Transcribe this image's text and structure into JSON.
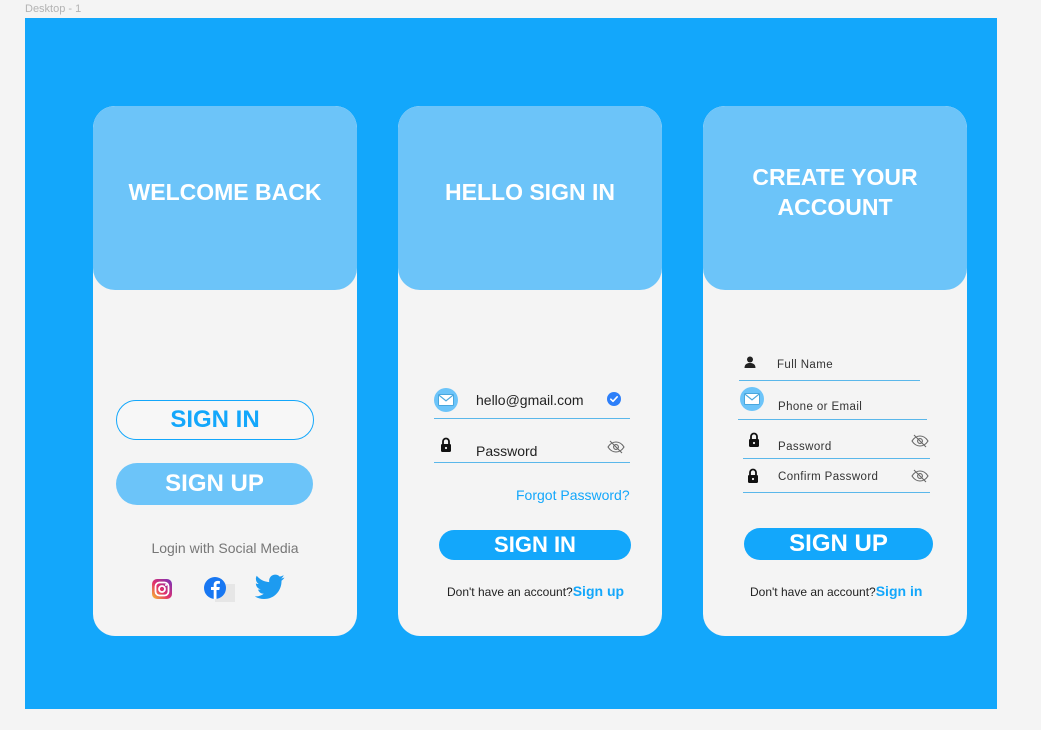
{
  "frame": {
    "label": "Desktop - 1"
  },
  "card1": {
    "title": "WELCOME BACK",
    "signin_label": "SIGN IN",
    "signup_label": "SIGN UP",
    "social_text": "Login with Social Media",
    "social_icons": [
      "instagram-icon",
      "facebook-icon",
      "twitter-icon"
    ]
  },
  "card2": {
    "title": "HELLO SIGN IN",
    "email_value": "hello@gmail.com",
    "password_placeholder": "Password",
    "forgot_label": "Forgot Password?",
    "signin_label": "SIGN IN",
    "footer_text": "Don't have an account?",
    "footer_link": "Sign up"
  },
  "card3": {
    "title": "CREATE YOUR ACCOUNT",
    "fullname_placeholder": "Full Name",
    "phone_email_placeholder": "Phone or Email",
    "password_placeholder": "Password",
    "confirm_password_placeholder": "Confirm Password",
    "signup_label": "SIGN UP",
    "footer_text": "Don't have an account?",
    "footer_link": "Sign in"
  },
  "colors": {
    "background": "#13a7fb",
    "header": "#6cc4f9",
    "card": "#f4f4f4",
    "accent": "#13a7fb"
  }
}
